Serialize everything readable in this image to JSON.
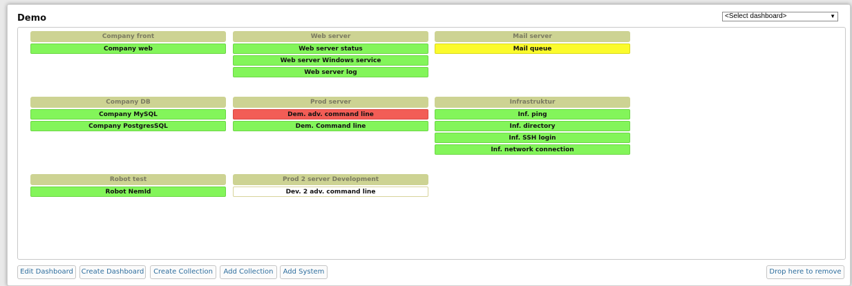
{
  "dashboard": {
    "title": "Demo"
  },
  "dashboard_select": {
    "value": "<Select dashboard>"
  },
  "collections": [
    {
      "name": "Company front",
      "systems": [
        {
          "label": "Company web",
          "status": "green"
        }
      ]
    },
    {
      "name": "Web server",
      "systems": [
        {
          "label": "Web server status",
          "status": "green"
        },
        {
          "label": "Web server Windows service",
          "status": "green"
        },
        {
          "label": "Web server log",
          "status": "green"
        }
      ]
    },
    {
      "name": "Mail server",
      "systems": [
        {
          "label": "Mail queue",
          "status": "yellow"
        }
      ]
    },
    {
      "name": "Company DB",
      "systems": [
        {
          "label": "Company MySQL",
          "status": "green"
        },
        {
          "label": "Company PostgresSQL",
          "status": "green"
        }
      ]
    },
    {
      "name": "Prod server",
      "systems": [
        {
          "label": "Dem. adv. command line",
          "status": "red"
        },
        {
          "label": "Dem. Command line",
          "status": "green"
        }
      ]
    },
    {
      "name": "Infrastruktur",
      "systems": [
        {
          "label": "Inf. ping",
          "status": "green"
        },
        {
          "label": "Inf. directory",
          "status": "green"
        },
        {
          "label": "Inf. SSH login",
          "status": "green"
        },
        {
          "label": "Inf. network connection",
          "status": "green"
        }
      ]
    },
    {
      "name": "Robot test",
      "systems": [
        {
          "label": "Robot NemId",
          "status": "green"
        }
      ]
    },
    {
      "name": "Prod 2 server Development",
      "systems": [
        {
          "label": "Dev. 2 adv. command line",
          "status": "white"
        }
      ]
    }
  ],
  "toolbar": {
    "edit_dashboard": "Edit Dashboard",
    "create_dashboard": "Create Dashboard",
    "create_collection": "Create Collection",
    "add_collection": "Add Collection",
    "add_system": "Add System",
    "drop_remove": "Drop here to remove"
  },
  "colors": {
    "green": "#83f55a",
    "yellow": "#fbfb2c",
    "red": "#f25d56",
    "white": "#ffffff",
    "collection_header": "#cdd393",
    "link": "#2e6e9e"
  }
}
